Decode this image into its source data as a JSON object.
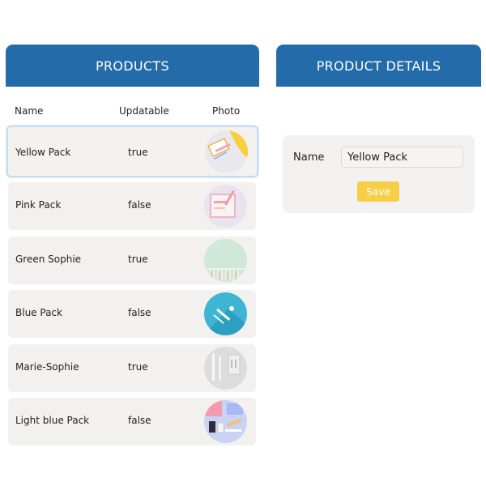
{
  "products": {
    "title": "PRODUCTS",
    "columns": [
      "Name",
      "Updatable",
      "Photo"
    ],
    "rows": [
      {
        "name": "Yellow Pack",
        "updatable": "true"
      },
      {
        "name": "Pink Pack",
        "updatable": "false"
      },
      {
        "name": "Green Sophie",
        "updatable": "true"
      },
      {
        "name": "Blue Pack",
        "updatable": "false"
      },
      {
        "name": "Marie-Sophie",
        "updatable": "true"
      },
      {
        "name": "Light blue Pack",
        "updatable": "false"
      }
    ]
  },
  "details": {
    "title": "PRODUCT DETAILS",
    "name_label": "Name",
    "name_value": "Yellow Pack",
    "save_label": "Save"
  },
  "colors": {
    "header": "#236ba9",
    "row_bg": "#f3f1ef",
    "selected_border": "#c7dcf2",
    "save_button": "#f7cf47"
  }
}
